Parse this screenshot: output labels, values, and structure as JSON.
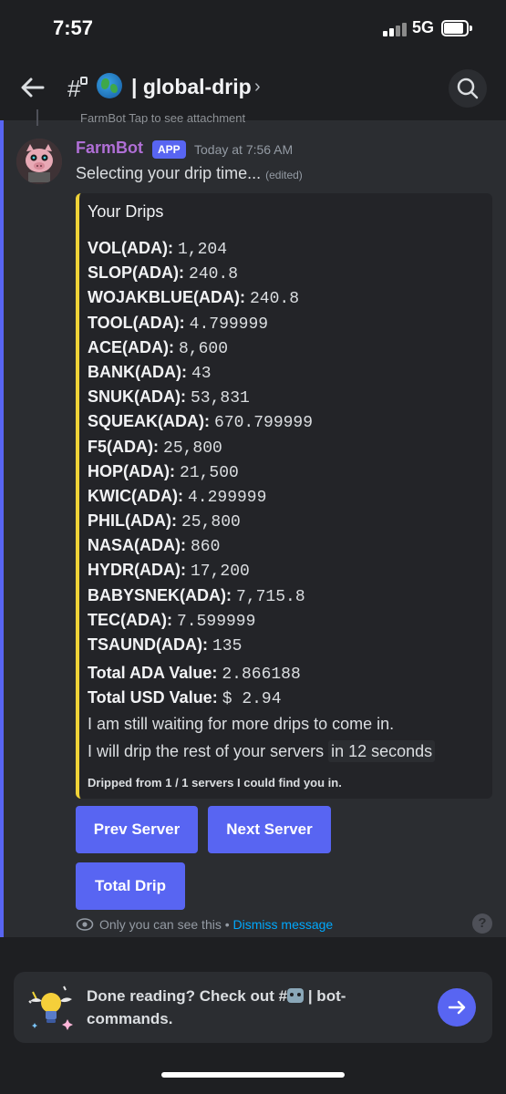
{
  "status_bar": {
    "time": "7:57",
    "network": "5G"
  },
  "header": {
    "channel_prefix": "#",
    "channel_name": "| global-drip",
    "chevron": "›",
    "icons": [
      "back-arrow-icon",
      "lock-icon",
      "globe-icon",
      "search-icon"
    ]
  },
  "previous_message": {
    "snippet": "FarmBot  Tap to see attachment"
  },
  "message": {
    "author": "FarmBot",
    "badge": "APP",
    "timestamp": "Today at 7:56 AM",
    "text": "Selecting your drip time...",
    "edited": "(edited)",
    "embed": {
      "title": "Your Drips",
      "accent_color": "#f0d338",
      "fields": [
        {
          "key": "VOL(ADA):",
          "value": "1,204"
        },
        {
          "key": "SLOP(ADA):",
          "value": "240.8"
        },
        {
          "key": "WOJAKBLUE(ADA):",
          "value": "240.8"
        },
        {
          "key": "TOOL(ADA):",
          "value": "4.799999"
        },
        {
          "key": "ACE(ADA):",
          "value": "8,600"
        },
        {
          "key": "BANK(ADA):",
          "value": "43"
        },
        {
          "key": "SNUK(ADA):",
          "value": "53,831"
        },
        {
          "key": "SQUEAK(ADA):",
          "value": "670.799999"
        },
        {
          "key": "F5(ADA):",
          "value": "25,800"
        },
        {
          "key": "HOP(ADA):",
          "value": "21,500"
        },
        {
          "key": "KWIC(ADA):",
          "value": "4.299999"
        },
        {
          "key": "PHIL(ADA):",
          "value": "25,800"
        },
        {
          "key": "NASA(ADA):",
          "value": "860"
        },
        {
          "key": "HYDR(ADA):",
          "value": "17,200"
        },
        {
          "key": "BABYSNEK(ADA):",
          "value": "7,715.8"
        },
        {
          "key": "TEC(ADA):",
          "value": "7.599999"
        },
        {
          "key": "TSAUND(ADA):",
          "value": "135"
        }
      ],
      "totals": [
        {
          "key": "Total ADA Value:",
          "value": "2.866188"
        },
        {
          "key": "Total USD Value:",
          "value": "$ 2.94"
        }
      ],
      "note_waiting": "I am still waiting for more drips to come in.",
      "note_rest_prefix": "I will drip the rest of your servers",
      "note_rest_highlight": "in 12 seconds",
      "footer": "Dripped from 1 / 1 servers I could find you in."
    },
    "buttons": {
      "prev": "Prev Server",
      "next": "Next Server",
      "total": "Total Drip"
    },
    "ephemeral": {
      "text": "Only you can see this •",
      "dismiss": "Dismiss message",
      "help": "?"
    }
  },
  "tip": {
    "prefix": "Done reading? Check out #",
    "channel": "| bot-",
    "channel_rest": "commands."
  },
  "colors": {
    "accent": "#5865f2",
    "author": "#b06fd6",
    "link": "#00a8fc",
    "embed_bar": "#f0d338"
  }
}
